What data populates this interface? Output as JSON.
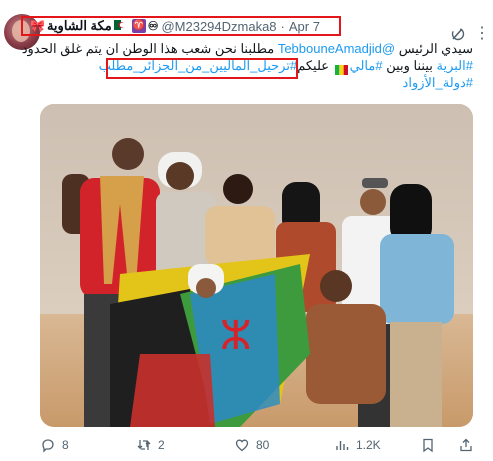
{
  "tweet": {
    "display_name": "مكة الشاوية",
    "handle": "@M23294Dzmaka8",
    "date": "Apr 7",
    "line1_a": "سيدي الرئيس ",
    "line1_mention": "@TebbouneAmadjid",
    "line1_b": " مطلبنا نحن شعب هذا الوطن ان يتم غلق الحدود",
    "line2_hashtag1": "#البرية",
    "line2_mid": " بيننا وبين ",
    "line2_hashtag2": "#مالي",
    "line2_after": " عليكم",
    "line2_hashtag3": "#ترحيل_الماليين_من_الجزائر_مطلب",
    "line3_hashtag": "#دولة_الأزواد"
  },
  "stats": {
    "replies": "8",
    "reposts": "2",
    "likes": "80",
    "views": "1.2K"
  },
  "colors": {
    "accent": "#1d9bf0",
    "highlight_box": "#e3161c",
    "muted": "#536471"
  },
  "icons": [
    "ribbon-icon",
    "algeria-flag-icon",
    "aries-icon",
    "infinity-icon",
    "grok-icon",
    "more-icon",
    "mali-flag-icon",
    "reply-icon",
    "repost-icon",
    "like-icon",
    "views-icon",
    "bookmark-icon",
    "share-icon"
  ]
}
